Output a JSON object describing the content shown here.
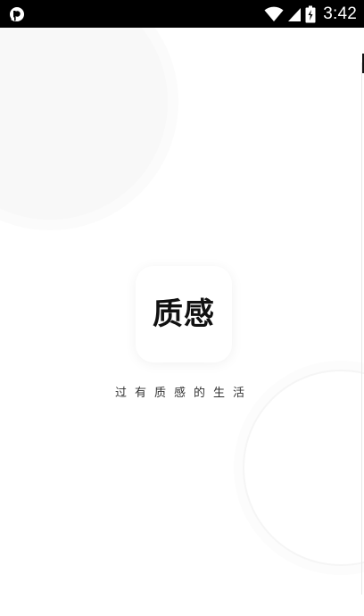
{
  "status_bar": {
    "left_icon": "app-notification-icon",
    "wifi_icon": "wifi-icon",
    "signal_icon": "cell-signal-icon",
    "battery_icon": "battery-charging-icon",
    "time": "3:42"
  },
  "splash": {
    "logo_text": "质感",
    "tagline": "过有质感的生活"
  },
  "colors": {
    "background": "#ffffff",
    "status_bar": "#000000",
    "logo_text": "#111111",
    "tagline": "#333333"
  }
}
